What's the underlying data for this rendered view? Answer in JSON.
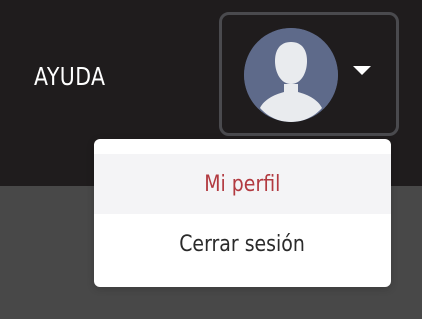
{
  "header": {
    "help_label": "AYUDA"
  },
  "user_menu": {
    "avatar_icon": "user-silhouette-icon",
    "toggle_icon": "caret-down-icon",
    "items": [
      {
        "label": "Mi perfil",
        "state": "hover"
      },
      {
        "label": "Cerrar sesión"
      }
    ]
  },
  "colors": {
    "header_bg": "#1f1c1d",
    "page_bg": "#484848",
    "avatar_bg": "#5e6a8a",
    "active_item_text": "#b23a40",
    "toggle_border": "#4a4a4e"
  }
}
